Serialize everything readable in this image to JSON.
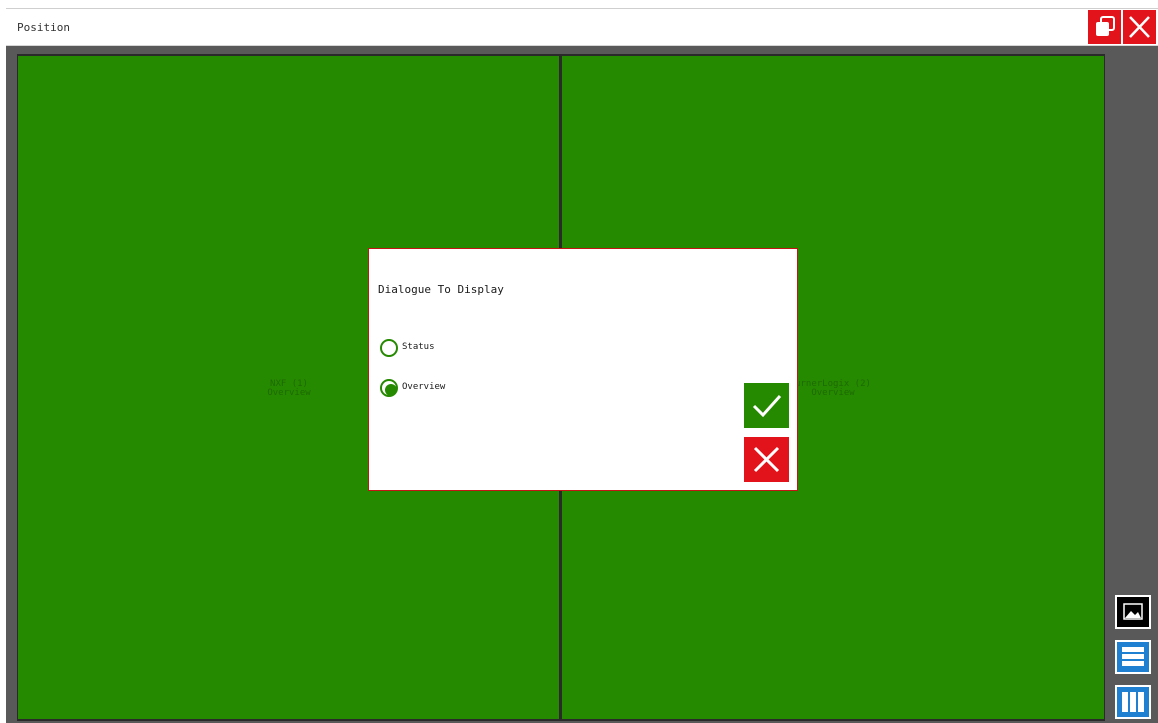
{
  "window": {
    "title": "Position",
    "restore_icon": "restore-window-icon",
    "close_icon": "close-icon",
    "accent_color": "#e3131b"
  },
  "panes": [
    {
      "label": "NXF (1)\nOverview",
      "color": "#268a00"
    },
    {
      "label": "urnerLogix (2)\nOverview",
      "color": "#268a00"
    }
  ],
  "sidebar": {
    "buttons": [
      {
        "icon": "image-icon"
      },
      {
        "icon": "rows-layout-icon"
      },
      {
        "icon": "columns-layout-icon"
      }
    ]
  },
  "dialog": {
    "title": "Dialogue To Display",
    "options": [
      {
        "label": "Status",
        "selected": false
      },
      {
        "label": "Overview",
        "selected": true
      }
    ],
    "confirm_icon": "checkmark-icon",
    "cancel_icon": "close-icon",
    "confirm_color": "#268a00",
    "cancel_color": "#e3131b"
  }
}
